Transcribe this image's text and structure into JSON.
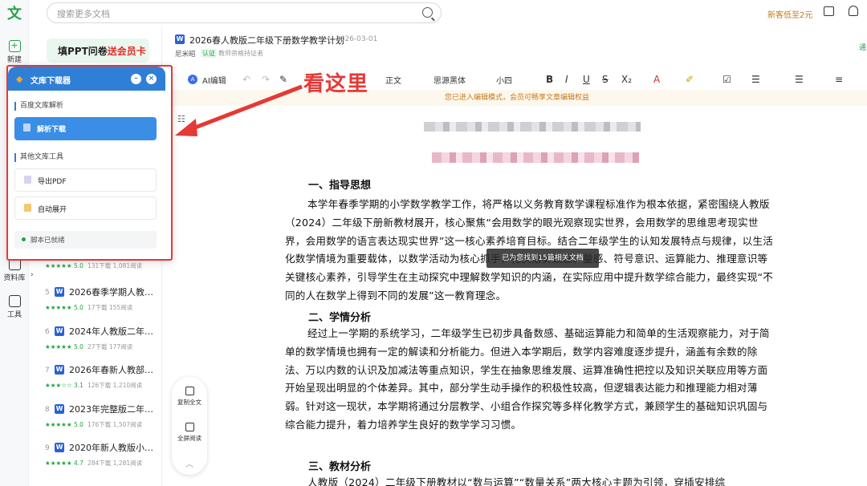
{
  "rail": {
    "logo": "文",
    "new_label": "新建",
    "library_label": "资料库",
    "tools_label": "工具"
  },
  "topbar": {
    "search_placeholder": "搜索更多文档",
    "promo": "新客低至2元"
  },
  "survey": {
    "text": "填PPT问卷",
    "highlight": "送会员卡"
  },
  "doc_list": [
    {
      "num": "",
      "title": "",
      "score": "5.0",
      "downloads": "131下载",
      "reads": "1,081阅读",
      "stars": "★★★★★"
    },
    {
      "num": "5",
      "title": "2026春季学期人教…",
      "score": "5.0",
      "downloads": "17下载",
      "reads": "155阅读",
      "stars": "★★★★★"
    },
    {
      "num": "6",
      "title": "2024年人教版二年…",
      "score": "5.0",
      "downloads": "27下载",
      "reads": "177阅读",
      "stars": "★★★★★"
    },
    {
      "num": "7",
      "title": "2026年春新人教部…",
      "score": "3.1",
      "downloads": "126下载",
      "reads": "1,210阅读",
      "stars": "★★★☆☆"
    },
    {
      "num": "8",
      "title": "2023年完整版二年…",
      "score": "5.0",
      "downloads": "176下载",
      "reads": "1,507阅读",
      "stars": "★★★★★"
    },
    {
      "num": "9",
      "title": "2020年新人教版小…",
      "score": "4.7",
      "downloads": "284下载",
      "reads": "1,281阅读",
      "stars": "★★★★★"
    }
  ],
  "doc": {
    "title": "2026春人教版二年级下册数学教学计划",
    "date": "2026-03-01",
    "author": "尼米昭",
    "badge": "认证",
    "cert": "教师资格持证者",
    "side_link": "通"
  },
  "toolbar": {
    "ai_label": "AI编辑",
    "style": "正文",
    "font": "思源黑体",
    "size": "小四"
  },
  "notice": "您已进入编辑模式，会员可畅享文章编辑权益",
  "content": {
    "h1": "一、指导思想",
    "p1": "本学年春季学期的小学数学教学工作，将严格以义务教育数学课程标准作为根本依据，紧密围绕人教版（2024）二年级下册新教材展开，核心聚焦“会用数学的眼光观察现实世界，会用数学的思维思考现实世界，会用数学的语言表达现实世界”这一核心素养培育目标。结合二年级学生的认知发展特点与规律，以生活化数学情境为重要载体，以数学活动为核心抓手，扎实落实数感、量感、符号意识、运算能力、推理意识等关键核心素养，引导学生在主动探究中理解数学知识的内涵，在实际应用中提升数学综合能力，最终实现“不同的人在数学上得到不同的发展”这一教育理念。",
    "h2": "二、学情分析",
    "p2": "经过上一学期的系统学习，二年级学生已初步具备数感、基础运算能力和简单的生活观察能力，对于简单的数学情境也拥有一定的解读和分析能力。但进入本学期后，数学内容难度逐步提升，涵盖有余数的除法、万以内数的认识及加减法等重点知识，学生在抽象思维发展、运算准确性把控以及知识关联应用等方面开始呈现出明显的个体差异。其中，部分学生动手操作的积极性较高，但逻辑表达能力和推理能力相对薄弱。针对这一现状，本学期将通过分层教学、小组合作探究等多样化教学方式，兼顾学生的基础知识巩固与综合能力提升，着力培养学生良好的数学学习习惯。",
    "h3": "三、教材分析",
    "p3": "人教版（2024）二年级下册教材以“数与运算”“数量关系”两大核心主题为引领，穿插安排综"
  },
  "toast": "已为您找到15篇相关文档",
  "float": {
    "copy": "复制全文",
    "fullscreen": "全屏阅读"
  },
  "panel": {
    "title": "文库下载器",
    "min": "–",
    "close": "×",
    "section1": "百度文库解析",
    "parse": "解析下载",
    "section2": "其他文库工具",
    "export": "导出PDF",
    "expand": "自动展开",
    "status": "脚本已就绪"
  },
  "annotation": "看这里",
  "colors": {
    "accent_green": "#25a244",
    "panel_blue": "#2f7fd6",
    "highlight_red": "#e53935"
  }
}
